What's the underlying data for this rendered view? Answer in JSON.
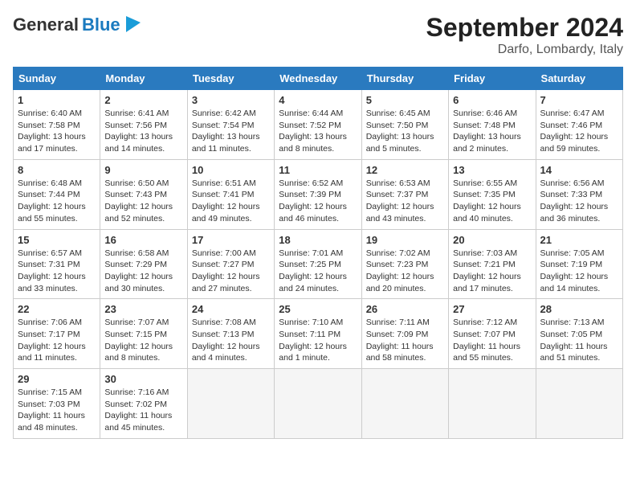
{
  "header": {
    "logo_general": "General",
    "logo_blue": "Blue",
    "month_title": "September 2024",
    "subtitle": "Darfo, Lombardy, Italy"
  },
  "days_of_week": [
    "Sunday",
    "Monday",
    "Tuesday",
    "Wednesday",
    "Thursday",
    "Friday",
    "Saturday"
  ],
  "weeks": [
    [
      {
        "day": "1",
        "lines": [
          "Sunrise: 6:40 AM",
          "Sunset: 7:58 PM",
          "Daylight: 13 hours",
          "and 17 minutes."
        ]
      },
      {
        "day": "2",
        "lines": [
          "Sunrise: 6:41 AM",
          "Sunset: 7:56 PM",
          "Daylight: 13 hours",
          "and 14 minutes."
        ]
      },
      {
        "day": "3",
        "lines": [
          "Sunrise: 6:42 AM",
          "Sunset: 7:54 PM",
          "Daylight: 13 hours",
          "and 11 minutes."
        ]
      },
      {
        "day": "4",
        "lines": [
          "Sunrise: 6:44 AM",
          "Sunset: 7:52 PM",
          "Daylight: 13 hours",
          "and 8 minutes."
        ]
      },
      {
        "day": "5",
        "lines": [
          "Sunrise: 6:45 AM",
          "Sunset: 7:50 PM",
          "Daylight: 13 hours",
          "and 5 minutes."
        ]
      },
      {
        "day": "6",
        "lines": [
          "Sunrise: 6:46 AM",
          "Sunset: 7:48 PM",
          "Daylight: 13 hours",
          "and 2 minutes."
        ]
      },
      {
        "day": "7",
        "lines": [
          "Sunrise: 6:47 AM",
          "Sunset: 7:46 PM",
          "Daylight: 12 hours",
          "and 59 minutes."
        ]
      }
    ],
    [
      {
        "day": "8",
        "lines": [
          "Sunrise: 6:48 AM",
          "Sunset: 7:44 PM",
          "Daylight: 12 hours",
          "and 55 minutes."
        ]
      },
      {
        "day": "9",
        "lines": [
          "Sunrise: 6:50 AM",
          "Sunset: 7:43 PM",
          "Daylight: 12 hours",
          "and 52 minutes."
        ]
      },
      {
        "day": "10",
        "lines": [
          "Sunrise: 6:51 AM",
          "Sunset: 7:41 PM",
          "Daylight: 12 hours",
          "and 49 minutes."
        ]
      },
      {
        "day": "11",
        "lines": [
          "Sunrise: 6:52 AM",
          "Sunset: 7:39 PM",
          "Daylight: 12 hours",
          "and 46 minutes."
        ]
      },
      {
        "day": "12",
        "lines": [
          "Sunrise: 6:53 AM",
          "Sunset: 7:37 PM",
          "Daylight: 12 hours",
          "and 43 minutes."
        ]
      },
      {
        "day": "13",
        "lines": [
          "Sunrise: 6:55 AM",
          "Sunset: 7:35 PM",
          "Daylight: 12 hours",
          "and 40 minutes."
        ]
      },
      {
        "day": "14",
        "lines": [
          "Sunrise: 6:56 AM",
          "Sunset: 7:33 PM",
          "Daylight: 12 hours",
          "and 36 minutes."
        ]
      }
    ],
    [
      {
        "day": "15",
        "lines": [
          "Sunrise: 6:57 AM",
          "Sunset: 7:31 PM",
          "Daylight: 12 hours",
          "and 33 minutes."
        ]
      },
      {
        "day": "16",
        "lines": [
          "Sunrise: 6:58 AM",
          "Sunset: 7:29 PM",
          "Daylight: 12 hours",
          "and 30 minutes."
        ]
      },
      {
        "day": "17",
        "lines": [
          "Sunrise: 7:00 AM",
          "Sunset: 7:27 PM",
          "Daylight: 12 hours",
          "and 27 minutes."
        ]
      },
      {
        "day": "18",
        "lines": [
          "Sunrise: 7:01 AM",
          "Sunset: 7:25 PM",
          "Daylight: 12 hours",
          "and 24 minutes."
        ]
      },
      {
        "day": "19",
        "lines": [
          "Sunrise: 7:02 AM",
          "Sunset: 7:23 PM",
          "Daylight: 12 hours",
          "and 20 minutes."
        ]
      },
      {
        "day": "20",
        "lines": [
          "Sunrise: 7:03 AM",
          "Sunset: 7:21 PM",
          "Daylight: 12 hours",
          "and 17 minutes."
        ]
      },
      {
        "day": "21",
        "lines": [
          "Sunrise: 7:05 AM",
          "Sunset: 7:19 PM",
          "Daylight: 12 hours",
          "and 14 minutes."
        ]
      }
    ],
    [
      {
        "day": "22",
        "lines": [
          "Sunrise: 7:06 AM",
          "Sunset: 7:17 PM",
          "Daylight: 12 hours",
          "and 11 minutes."
        ]
      },
      {
        "day": "23",
        "lines": [
          "Sunrise: 7:07 AM",
          "Sunset: 7:15 PM",
          "Daylight: 12 hours",
          "and 8 minutes."
        ]
      },
      {
        "day": "24",
        "lines": [
          "Sunrise: 7:08 AM",
          "Sunset: 7:13 PM",
          "Daylight: 12 hours",
          "and 4 minutes."
        ]
      },
      {
        "day": "25",
        "lines": [
          "Sunrise: 7:10 AM",
          "Sunset: 7:11 PM",
          "Daylight: 12 hours",
          "and 1 minute."
        ]
      },
      {
        "day": "26",
        "lines": [
          "Sunrise: 7:11 AM",
          "Sunset: 7:09 PM",
          "Daylight: 11 hours",
          "and 58 minutes."
        ]
      },
      {
        "day": "27",
        "lines": [
          "Sunrise: 7:12 AM",
          "Sunset: 7:07 PM",
          "Daylight: 11 hours",
          "and 55 minutes."
        ]
      },
      {
        "day": "28",
        "lines": [
          "Sunrise: 7:13 AM",
          "Sunset: 7:05 PM",
          "Daylight: 11 hours",
          "and 51 minutes."
        ]
      }
    ],
    [
      {
        "day": "29",
        "lines": [
          "Sunrise: 7:15 AM",
          "Sunset: 7:03 PM",
          "Daylight: 11 hours",
          "and 48 minutes."
        ]
      },
      {
        "day": "30",
        "lines": [
          "Sunrise: 7:16 AM",
          "Sunset: 7:02 PM",
          "Daylight: 11 hours",
          "and 45 minutes."
        ]
      },
      null,
      null,
      null,
      null,
      null
    ]
  ]
}
